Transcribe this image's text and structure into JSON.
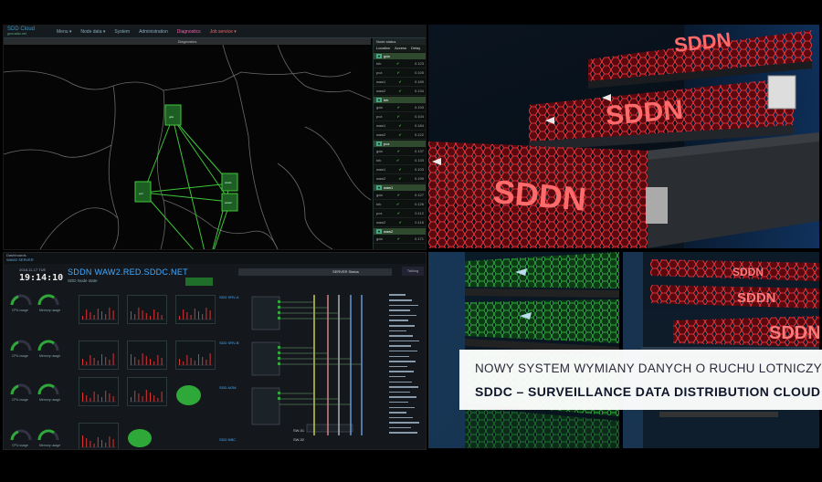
{
  "map_app": {
    "brand": "SDD Cloud",
    "brand_sub": "gsm.sddc.net",
    "menu": [
      "Menu ▾",
      "Node data ▾",
      "System",
      "Administration",
      "Diagnostics",
      "Job service ▾"
    ],
    "active_menu_index": 4,
    "view_title": "Diagnostics",
    "nodes_panel": {
      "title": "Node status",
      "headers": [
        "Location",
        "Access",
        "Delay"
      ],
      "groups": [
        {
          "name": "gda",
          "rows": [
            [
              "krk",
              "✔",
              "0.123"
            ],
            [
              "poz",
              "✔",
              "0.105"
            ],
            [
              "waw1",
              "✔",
              "0.189"
            ],
            [
              "waw2",
              "✔",
              "0.134"
            ]
          ]
        },
        {
          "name": "krk",
          "rows": [
            [
              "gda",
              "✔",
              "0.193"
            ],
            [
              "poz",
              "✔",
              "0.104"
            ],
            [
              "waw1",
              "✔",
              "0.184"
            ],
            [
              "waw2",
              "✔",
              "0.122"
            ]
          ]
        },
        {
          "name": "poz",
          "rows": [
            [
              "gda",
              "✔",
              "0.137"
            ],
            [
              "krk",
              "✔",
              "0.133"
            ],
            [
              "waw1",
              "✔",
              "0.103"
            ],
            [
              "waw2",
              "✔",
              "0.199"
            ]
          ]
        },
        {
          "name": "waw1",
          "rows": [
            [
              "gda",
              "✔",
              "0.127"
            ],
            [
              "krk",
              "✔",
              "0.126"
            ],
            [
              "poz",
              "✔",
              "0.112"
            ],
            [
              "waw2",
              "✔",
              "0.116"
            ]
          ]
        },
        {
          "name": "waw2",
          "rows": [
            [
              "gda",
              "✔",
              "0.171"
            ]
          ]
        }
      ]
    },
    "map_nodes": [
      "gda",
      "poz",
      "waw1",
      "waw2",
      "krk"
    ]
  },
  "dashboard": {
    "tab_label": "Dashboards",
    "tab_sub": "WAW2 SERVER",
    "date": "2018-11-17 TUE",
    "clock": "19:14:10",
    "title": "SDDN WAW2.RED.SDDC.NET",
    "subtitle": "SDD Node state",
    "status_label": "SERVER Status",
    "talking_label": "Talking",
    "gauge_labels": [
      "CPU usage",
      "Memory usage",
      "CPU usage",
      "Memory usage",
      "CPU usage",
      "Memory usage",
      "CPU usage",
      "Memory usage"
    ],
    "sections": [
      "SDD SRV-A",
      "SDD SRV-B",
      "SDD AOM",
      "SDD NBC"
    ],
    "bottom_labels": [
      "SW-01",
      "SW-02"
    ]
  },
  "caption": {
    "line1": "NOWY SYSTEM WYMIANY DANYCH O RUCHU LOTNICZYM",
    "line2": "SDDC – SURVEILLANCE DATA DISTRIBUTION CLOUD"
  },
  "photo_labels": {
    "server_brand": "SDDN"
  },
  "colors": {
    "accent_green": "#2ea838",
    "server_red": "#d8202a",
    "dashboard_blue": "#44aaff"
  }
}
